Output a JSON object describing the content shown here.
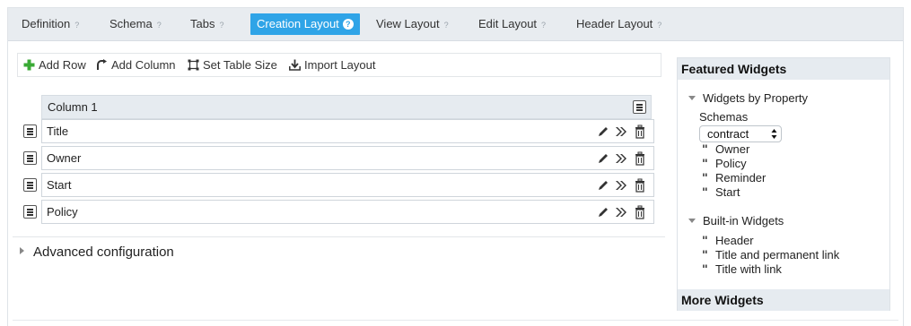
{
  "tabs": [
    {
      "label": "Definition",
      "q": "?"
    },
    {
      "label": "Schema",
      "q": "?"
    },
    {
      "label": "Tabs",
      "q": "?"
    },
    {
      "label": "Creation Layout",
      "q": "?"
    },
    {
      "label": "View Layout",
      "q": "?"
    },
    {
      "label": "Edit Layout",
      "q": "?"
    },
    {
      "label": "Header Layout",
      "q": "?"
    }
  ],
  "active_tab": "Creation Layout",
  "toolbar": {
    "add_row": "Add Row",
    "add_column": "Add Column",
    "set_table_size": "Set Table Size",
    "import_layout": "Import Layout"
  },
  "layout": {
    "column_title": "Column 1",
    "rows": [
      {
        "label": "Title"
      },
      {
        "label": "Owner"
      },
      {
        "label": "Start"
      },
      {
        "label": "Policy"
      }
    ]
  },
  "advanced": {
    "label": "Advanced configuration"
  },
  "widgets": {
    "featured_title": "Featured Widgets",
    "by_property": {
      "label": "Widgets by Property",
      "schemas_label": "Schemas",
      "schema_selected": "contract",
      "items": [
        "Owner",
        "Policy",
        "Reminder",
        "Start"
      ]
    },
    "builtin": {
      "label": "Built-in Widgets",
      "items": [
        "Header",
        "Title and permanent link",
        "Title with link"
      ]
    },
    "more_title": "More Widgets"
  },
  "colors": {
    "accent": "#2fa4e7",
    "add_green": "#3aaa35",
    "tab_bar": "#e8ecf0"
  }
}
